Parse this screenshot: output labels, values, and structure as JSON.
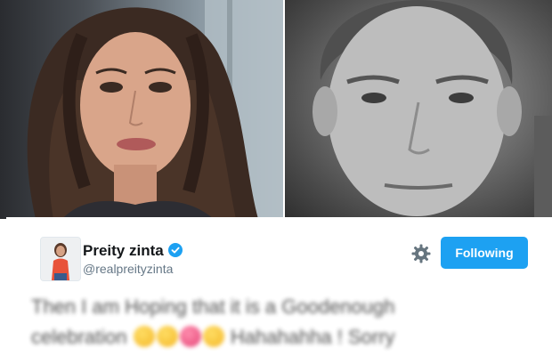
{
  "photos": {
    "left_icon": "portrait-photo-woman",
    "right_icon": "portrait-photo-man-grayscale"
  },
  "tweet": {
    "display_name": "Preity zinta",
    "handle": "@realpreityzinta",
    "verified_icon": "verified-badge-icon",
    "settings_icon": "gear-icon",
    "follow_label": "Following",
    "text_lines": [
      "Then I am Hoping that it is a Goodenough",
      "celebration",
      "Hahahahha ! Sorry"
    ]
  },
  "colors": {
    "accent": "#1da1f2",
    "name_text": "#14171a",
    "handle_text": "#657786",
    "tweet_text": "#333333"
  }
}
